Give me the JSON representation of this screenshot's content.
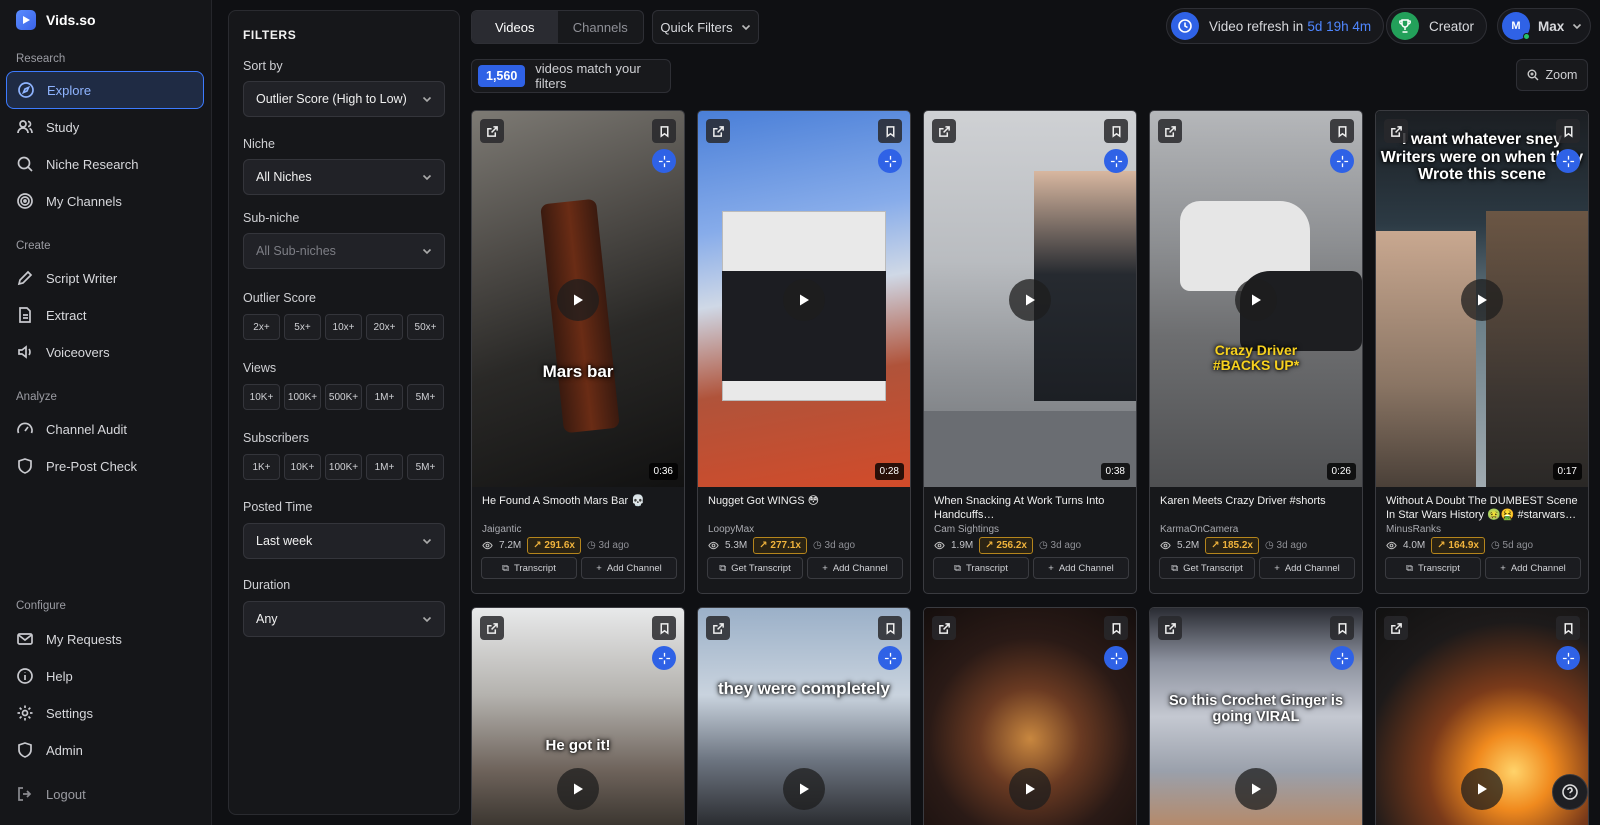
{
  "app": {
    "name": "Vids.so"
  },
  "sidebar": {
    "sections": [
      {
        "label": "Research",
        "items": [
          {
            "label": "Explore",
            "icon": "compass-icon",
            "active": true
          },
          {
            "label": "Study",
            "icon": "users-icon"
          },
          {
            "label": "Niche Research",
            "icon": "search-icon"
          },
          {
            "label": "My Channels",
            "icon": "target-icon"
          }
        ]
      },
      {
        "label": "Create",
        "items": [
          {
            "label": "Script Writer",
            "icon": "pen-icon"
          },
          {
            "label": "Extract",
            "icon": "file-icon"
          },
          {
            "label": "Voiceovers",
            "icon": "speaker-icon"
          }
        ]
      },
      {
        "label": "Analyze",
        "items": [
          {
            "label": "Channel Audit",
            "icon": "gauge-icon"
          },
          {
            "label": "Pre-Post Check",
            "icon": "shield-check-icon"
          }
        ]
      },
      {
        "label": "Configure",
        "items": [
          {
            "label": "My Requests",
            "icon": "mail-icon"
          },
          {
            "label": "Help",
            "icon": "info-icon"
          },
          {
            "label": "Settings",
            "icon": "gear-icon"
          },
          {
            "label": "Admin",
            "icon": "shield-icon"
          }
        ]
      }
    ],
    "logout": "Logout"
  },
  "filters": {
    "title": "FILTERS",
    "sort_label": "Sort by",
    "sort_value": "Outlier Score (High to Low)",
    "niche_label": "Niche",
    "niche_value": "All Niches",
    "subniche_label": "Sub-niche",
    "subniche_value": "All Sub-niches",
    "outlier_label": "Outlier Score",
    "outlier_options": [
      "2x+",
      "5x+",
      "10x+",
      "20x+",
      "50x+"
    ],
    "views_label": "Views",
    "views_options": [
      "10K+",
      "100K+",
      "500K+",
      "1M+",
      "5M+"
    ],
    "subs_label": "Subscribers",
    "subs_options": [
      "1K+",
      "10K+",
      "100K+",
      "1M+",
      "5M+"
    ],
    "posted_label": "Posted Time",
    "posted_value": "Last week",
    "duration_label": "Duration",
    "duration_value": "Any"
  },
  "topbar": {
    "tab_videos": "Videos",
    "tab_channels": "Channels",
    "quick_filters": "Quick Filters",
    "match_count": "1,560",
    "match_text": "videos match your filters",
    "refresh_text": "Video refresh in",
    "refresh_time": "5d 19h 4m",
    "plan": "Creator",
    "user_initial": "M",
    "user_name": "Max",
    "zoom": "Zoom"
  },
  "videos": [
    {
      "title": "He Found A Smooth Mars Bar 💀",
      "channel": "Jaigantic",
      "views": "7.2M",
      "outlier": "291.6x",
      "ago": "3d ago",
      "duration": "0:36",
      "left_btn": "Transcript",
      "right_btn": "Add Channel",
      "caption": "Mars bar"
    },
    {
      "title": "Nugget Got WINGS 😳",
      "channel": "LoopyMax",
      "views": "5.3M",
      "outlier": "277.1x",
      "ago": "3d ago",
      "duration": "0:28",
      "left_btn": "Get Transcript",
      "right_btn": "Add Channel",
      "caption": ""
    },
    {
      "title": "When Snacking At Work Turns Into Handcuffs…",
      "channel": "Cam Sightings",
      "views": "1.9M",
      "outlier": "256.2x",
      "ago": "3d ago",
      "duration": "0:38",
      "left_btn": "Transcript",
      "right_btn": "Add Channel",
      "caption": ""
    },
    {
      "title": "Karen Meets Crazy Driver #shorts",
      "channel": "KarmaOnCamera",
      "views": "5.2M",
      "outlier": "185.2x",
      "ago": "3d ago",
      "duration": "0:26",
      "left_btn": "Get Transcript",
      "right_btn": "Add Channel",
      "caption": "Crazy Driver #BACKS UP*"
    },
    {
      "title": "Without A Doubt The DUMBEST Scene In Star Wars History 🤢🤮 #starwars…",
      "channel": "MinusRanks",
      "views": "4.0M",
      "outlier": "164.9x",
      "ago": "5d ago",
      "duration": "0:17",
      "left_btn": "Transcript",
      "right_btn": "Add Channel",
      "caption": "I want whatever sney Writers were on when they Wrote this scene"
    },
    {
      "caption": "He got it!"
    },
    {
      "caption": "they were completely"
    },
    {
      "caption": ""
    },
    {
      "caption": "So this Crochet Ginger is going VIRAL"
    },
    {
      "caption": ""
    }
  ],
  "colors": {
    "accent": "#2f62e6",
    "outlier": "#f0b33c",
    "active_nav": "#3d7bff"
  }
}
